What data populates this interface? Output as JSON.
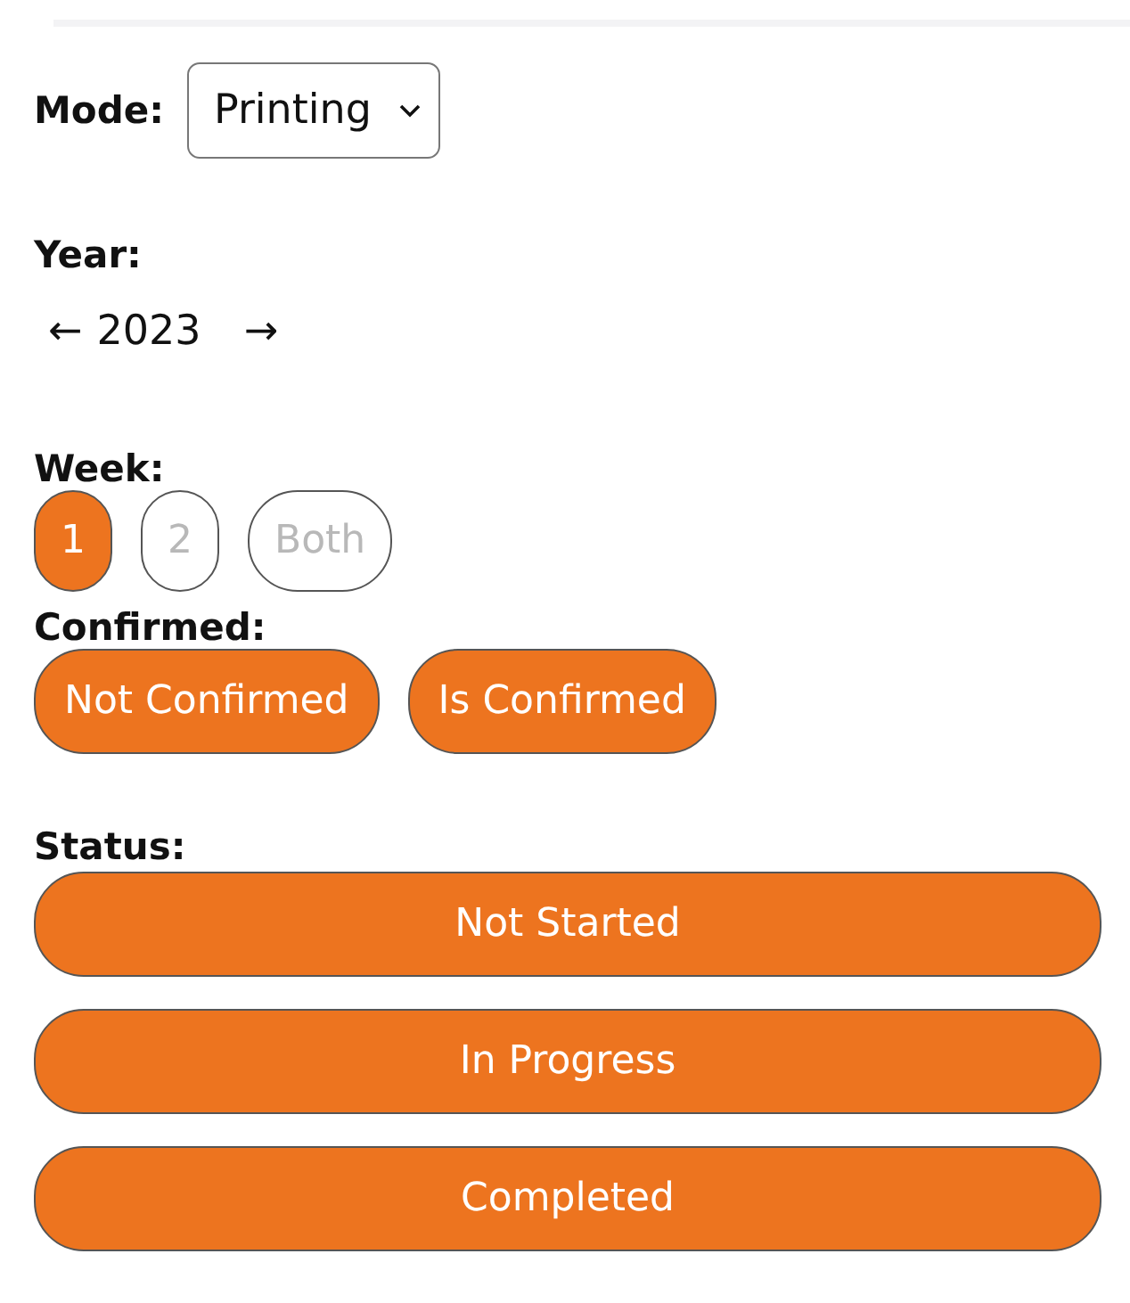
{
  "mode": {
    "label": "Mode:",
    "value": "Printing"
  },
  "year": {
    "label": "Year:",
    "prev": "←",
    "value": "2023",
    "next": "→"
  },
  "week": {
    "label": "Week:",
    "options": [
      {
        "label": "1",
        "selected": true
      },
      {
        "label": "2",
        "selected": false
      },
      {
        "label": "Both",
        "selected": false
      }
    ]
  },
  "confirmed": {
    "label": "Confirmed:",
    "options": [
      {
        "label": "Not Confirmed",
        "selected": true
      },
      {
        "label": "Is Confirmed",
        "selected": true
      }
    ]
  },
  "status": {
    "label": "Status:",
    "options": [
      {
        "label": "Not Started",
        "selected": true
      },
      {
        "label": "In Progress",
        "selected": true
      },
      {
        "label": "Completed",
        "selected": true
      }
    ]
  }
}
